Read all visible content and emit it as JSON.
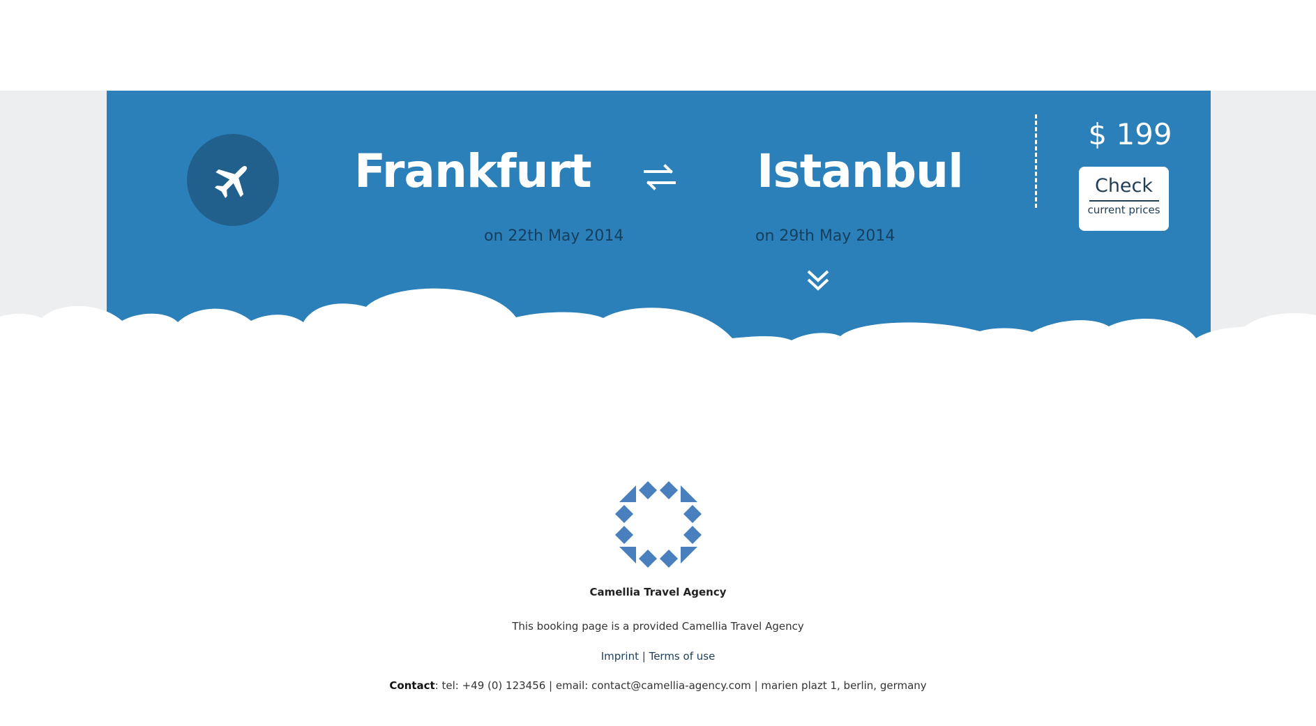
{
  "flight": {
    "from_city": "Frankfurt",
    "to_city": "Istanbul",
    "from_date": "on 22th May 2014",
    "to_date": "on 29th May 2014"
  },
  "price": {
    "amount": "$ 199",
    "button_title": "Check",
    "button_subtitle": "current prices"
  },
  "icons": {
    "plane": "airplane-icon",
    "swap": "swap-arrows-icon",
    "expand": "double-chevron-down-icon",
    "logo": "camellia-logo"
  },
  "footer": {
    "agency_name": "Camellia Travel Agency",
    "notice": "This booking page is a provided Camellia Travel Agency",
    "imprint": "Imprint",
    "separator": " | ",
    "terms": "Terms of use",
    "contact_label": "Contact",
    "contact_text": ": tel: +49 (0) 123456 | email: contact@camellia-agency.com | marien plazt 1, berlin, germany"
  },
  "colors": {
    "hero_blue": "#2b80b9",
    "circle_blue": "#215f8d",
    "band_gray": "#eceeef",
    "logo_blue": "#4a7fbe",
    "text_dark": "#1f3d57"
  }
}
